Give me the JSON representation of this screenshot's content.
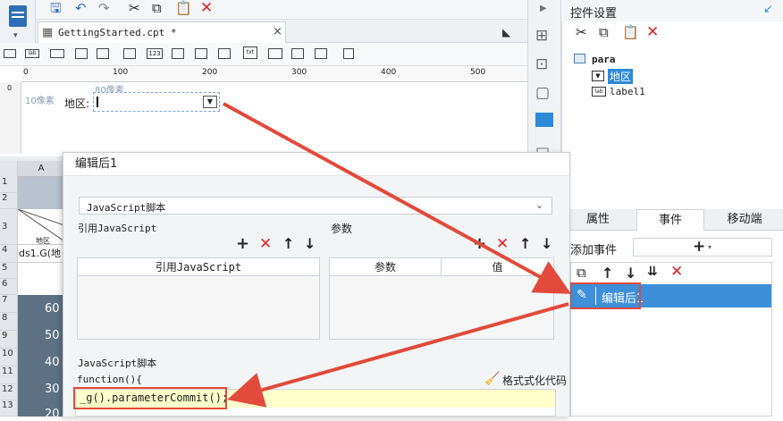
{
  "tab": {
    "title": "GettingStarted.cpt *",
    "close": "×"
  },
  "ruler": {
    "ticks": [
      "0",
      "100",
      "200",
      "300",
      "400",
      "500"
    ]
  },
  "canvas": {
    "dist_top": "80像素",
    "dist_left": "10像素",
    "label_text": "地区:",
    "vruler_mark": "0"
  },
  "sheet": {
    "col_a": "A",
    "rows": [
      "1",
      "2",
      "3",
      "4",
      "5",
      "6",
      "7",
      "8",
      "9",
      "10",
      "11",
      "12",
      "13"
    ],
    "cell_region": "地区",
    "cell_ds": "ds1.G(地",
    "yaxis": [
      "60",
      "50",
      "40",
      "30",
      "20"
    ]
  },
  "dialog": {
    "title": "编辑后1",
    "type_select": "JavaScript脚本",
    "ref_js_label": "引用JavaScript",
    "params_label": "参数",
    "ref_js_header": "引用JavaScript",
    "param_header": "参数",
    "value_header": "值",
    "script_label": "JavaScript脚本",
    "func_sig": "function(){",
    "format_code": "格式式化代码",
    "code_line": "_g().parameterCommit();",
    "toolbar": {
      "add": "+",
      "remove": "✕",
      "up": "↑",
      "down": "↓"
    }
  },
  "right_panel": {
    "title": "控件设置",
    "tree": {
      "root": "para",
      "child1": "地区",
      "child2": "label1"
    },
    "tabs": [
      "属性",
      "事件",
      "移动端"
    ],
    "add_event_label": "添加事件",
    "add_button": "+",
    "event_item": "编辑后1"
  },
  "colors": {
    "accent": "#2d8ad8",
    "selected": "#3d8fd9",
    "highlight_red": "#e24a3b",
    "code_bg": "#ffffcc"
  }
}
